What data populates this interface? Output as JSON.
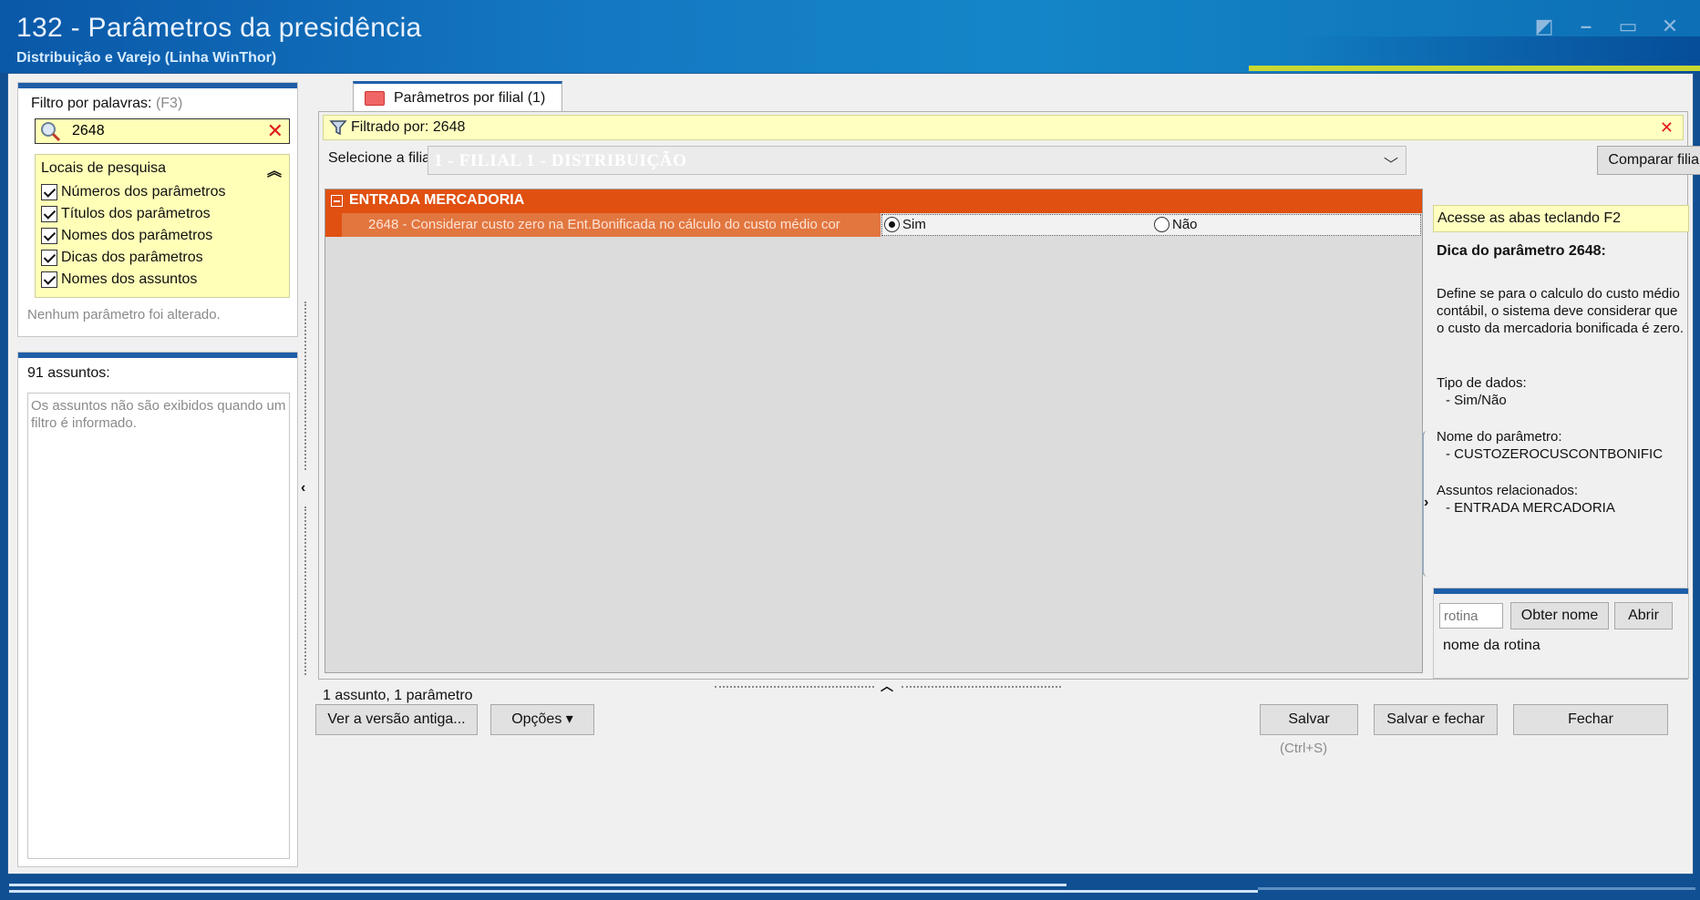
{
  "window": {
    "title": "132 - Parâmetros da presidência",
    "subtitle": "Distribuição e Varejo (Linha WinThor)"
  },
  "filter": {
    "label": "Filtro por palavras:",
    "shortcut": "(F3)",
    "value": "2648",
    "search_locations_title": "Locais de pesquisa",
    "options": [
      {
        "label": "Números dos parâmetros",
        "checked": true
      },
      {
        "label": "Títulos dos parâmetros",
        "checked": true
      },
      {
        "label": "Nomes dos parâmetros",
        "checked": true
      },
      {
        "label": "Dicas dos parâmetros",
        "checked": true
      },
      {
        "label": "Nomes dos assuntos",
        "checked": true
      }
    ],
    "no_change_text": "Nenhum parâmetro foi alterado."
  },
  "subjects": {
    "count_label": "91 assuntos:",
    "note": "Os assuntos não são exibidos quando um filtro é informado."
  },
  "tabs": [
    {
      "label": "Parâmetros por filial  (1)",
      "active": true
    }
  ],
  "filter_bar": {
    "text": "Filtrado por: 2648"
  },
  "filial": {
    "label": "Selecione a filial:",
    "value": "1 - FILIAL 1 - DISTRIBUIÇÃO"
  },
  "compare_button": "Comparar filiais",
  "grid": {
    "group": "ENTRADA MERCADORIA",
    "rows": [
      {
        "text": "2648 - Considerar custo zero na Ent.Bonificada no cálculo do custo médio cor",
        "options": [
          "Sim",
          "Não"
        ],
        "selected": "Sim"
      }
    ]
  },
  "summary": "1 assunto, 1 parâmetro",
  "tip": {
    "banner": "Acesse as abas teclando F2",
    "title": "Dica do parâmetro 2648:",
    "description": "Define se para o calculo do custo médio contábil, o sistema deve considerar que o custo da mercadoria bonificada é zero.",
    "data_type_label": "Tipo de dados:",
    "data_type_value": "- Sim/Não",
    "param_name_label": "Nome do parâmetro:",
    "param_name_value": "- CUSTOZEROCUSCONTBONIFIC",
    "related_label": "Assuntos relacionados:",
    "related_value": "- ENTRADA MERCADORIA"
  },
  "rotina": {
    "placeholder": "rotina",
    "get_name_button": "Obter nome",
    "open_button": "Abrir",
    "name_label": "nome da rotina"
  },
  "footer": {
    "old_version_button": "Ver a versão antiga...",
    "options_button": "Opções ▾",
    "save_button": "Salvar",
    "save_shortcut": "(Ctrl+S)",
    "save_close_button": "Salvar e fechar",
    "close_button": "Fechar"
  },
  "colors": {
    "group_header": "#e05010",
    "row_highlight": "#e2763f",
    "accent_bar": "#1f5fa8",
    "hint_yellow": "#ffffc0"
  }
}
